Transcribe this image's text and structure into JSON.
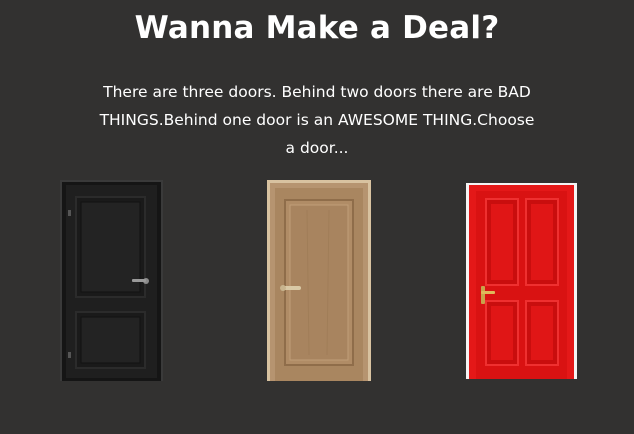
{
  "page": {
    "title": "Wanna Make a Deal?",
    "intro": "There are three doors. Behind two doors there are BAD THINGS.Behind one door is an AWESOME THING.Choose a door..."
  },
  "doors": [
    {
      "icon": "black-door-icon",
      "color": "#1e1e1e"
    },
    {
      "icon": "wooden-door-icon",
      "color": "#a8845f"
    },
    {
      "icon": "red-door-icon",
      "color": "#dc1414"
    }
  ]
}
